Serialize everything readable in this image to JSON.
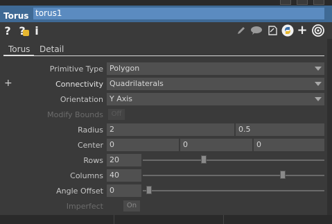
{
  "header": {
    "op_type": "Torus",
    "op_name": "torus1"
  },
  "toolbar": {
    "left_icons": [
      "help-icon",
      "python-help-icon",
      "info-icon"
    ],
    "right_icons": [
      "edit-icon",
      "comment-icon",
      "notes-icon",
      "python-icon",
      "add-icon",
      "target-icon"
    ],
    "accent": "#3f6a95"
  },
  "tabs": [
    {
      "label": "Torus",
      "active": true
    },
    {
      "label": "Detail",
      "active": false
    }
  ],
  "params": {
    "primitive_type": {
      "label": "Primitive Type",
      "value": "Polygon"
    },
    "connectivity": {
      "label": "Connectivity",
      "value": "Quadrilaterals"
    },
    "orientation": {
      "label": "Orientation",
      "value": "Y Axis"
    },
    "modify_bounds": {
      "label": "Modify Bounds",
      "value": "Off"
    },
    "radius": {
      "label": "Radius",
      "values": [
        "2",
        "0.5"
      ]
    },
    "center": {
      "label": "Center",
      "values": [
        "0",
        "0",
        "0"
      ]
    },
    "rows": {
      "label": "Rows",
      "value": "20",
      "slider_fraction": 0.33
    },
    "columns": {
      "label": "Columns",
      "value": "40",
      "slider_fraction": 0.78
    },
    "angle_offset": {
      "label": "Angle Offset",
      "value": "0",
      "slider_fraction": 0.02
    },
    "imperfect": {
      "label": "Imperfect",
      "value": "On"
    }
  }
}
